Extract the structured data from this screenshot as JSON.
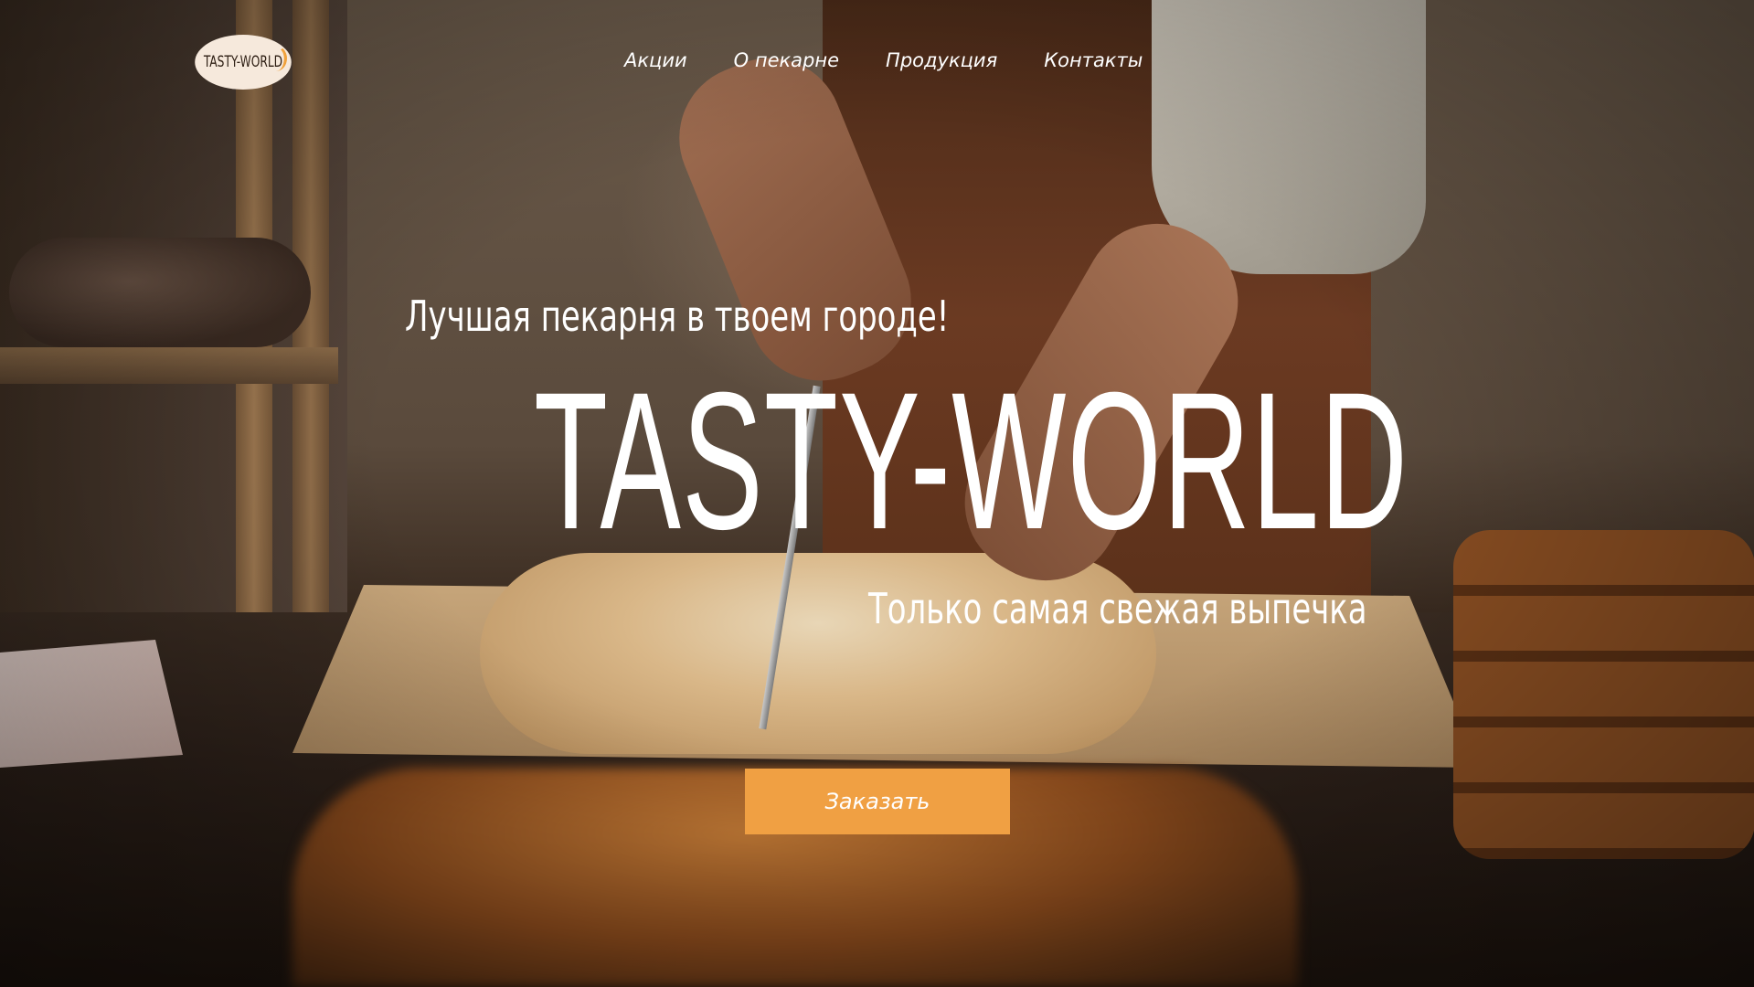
{
  "header": {
    "logo_text": "TASTY-WORLD",
    "nav": [
      {
        "label": "Акции"
      },
      {
        "label": "О пекарне"
      },
      {
        "label": "Продукция"
      },
      {
        "label": "Контакты"
      }
    ]
  },
  "hero": {
    "tagline": "Лучшая пекарня в твоем городе!",
    "brand": "TASTY-WORLD",
    "subline": "Только самая свежая выпечка",
    "order_button": "Заказать"
  },
  "colors": {
    "accent": "#f0a043",
    "logo_bg": "#f6e9dc",
    "text": "#ffffff"
  },
  "icons": {
    "logo_mark": "orange-swoosh-icon"
  }
}
